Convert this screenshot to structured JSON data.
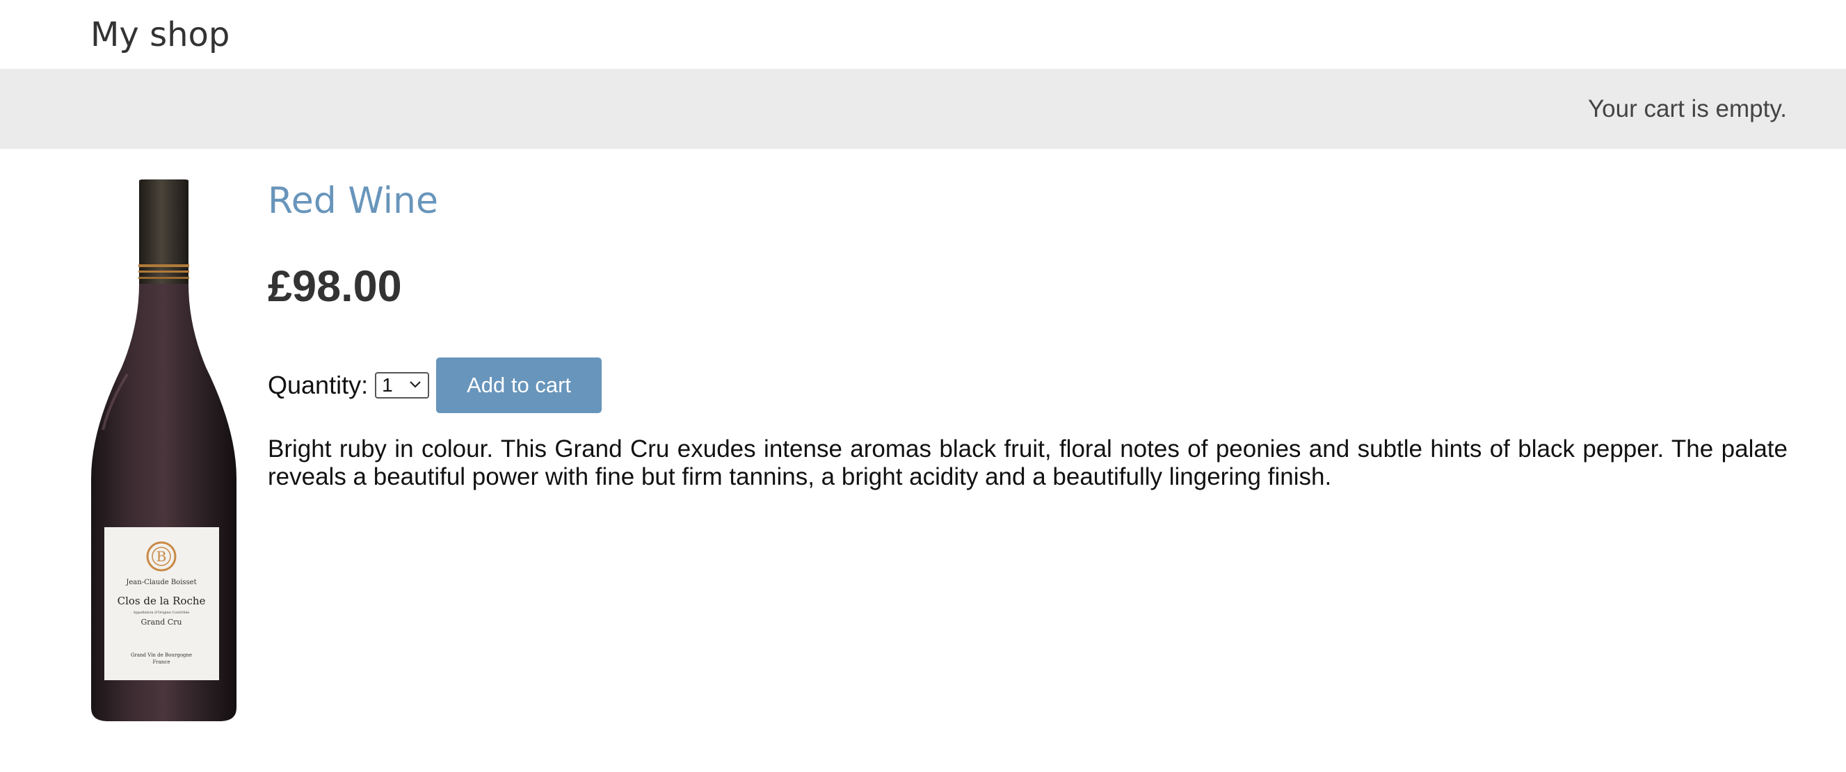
{
  "header": {
    "shop_title": "My shop"
  },
  "cart": {
    "status": "Your cart is empty."
  },
  "product": {
    "name": "Red Wine",
    "price": "£98.00",
    "quantity_label": "Quantity:",
    "quantity_value": "1",
    "add_to_cart_label": "Add to cart",
    "description": "Bright ruby in colour. This Grand Cru exudes intense aromas black fruit, floral notes of peonies and subtle hints of black pepper. The palate reveals a beautiful power with fine but firm tannins, a bright acidity and a beautifully lingering finish.",
    "image": {
      "label_producer": "Jean-Claude Boisset",
      "label_wine": "Clos de la Roche",
      "label_appellation": "Appellation d'Origine Contrôlée",
      "label_cru": "Grand Cru",
      "label_region": "Grand Vin de Bourgogne",
      "label_country": "France"
    }
  },
  "colors": {
    "accent": "#6895bb",
    "cart_bar": "#ebebeb"
  }
}
